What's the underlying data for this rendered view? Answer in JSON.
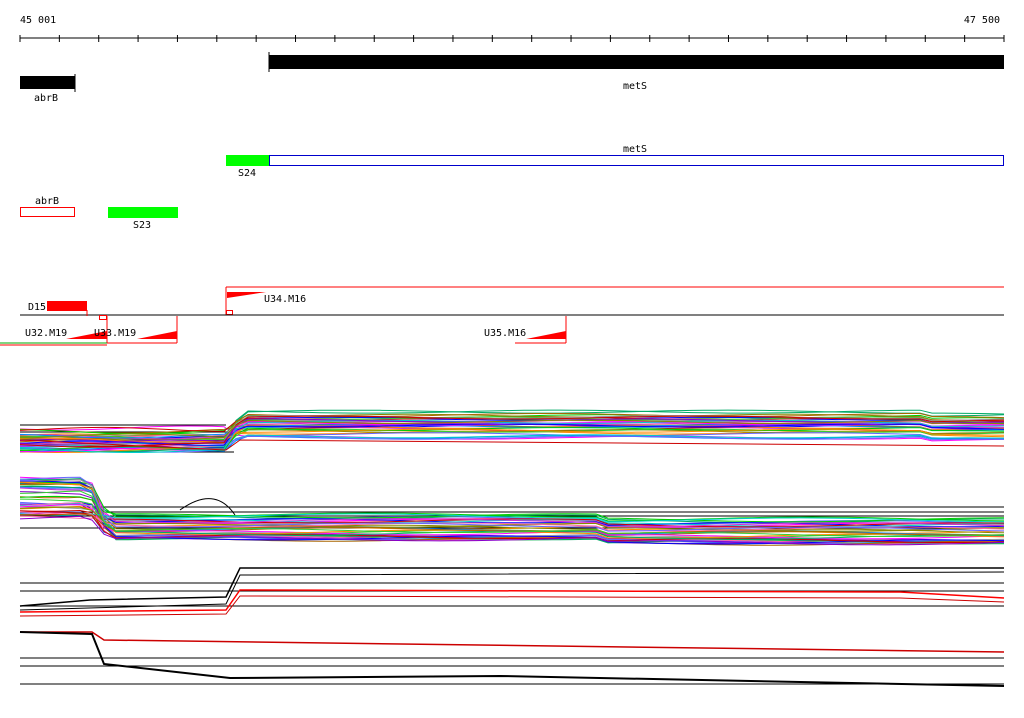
{
  "ruler": {
    "start_label": "45 001",
    "end_label": "47 500"
  },
  "genes": [
    {
      "label": "abrB"
    },
    {
      "label": "metS"
    }
  ],
  "transcripts": [
    {
      "label": "metS"
    },
    {
      "label": "S24"
    },
    {
      "label": "abrB"
    },
    {
      "label": "S23"
    }
  ],
  "segments": [
    {
      "label": "U34.M16"
    },
    {
      "label": "D15"
    },
    {
      "label": "U32.M19"
    },
    {
      "label": "U33.M19"
    },
    {
      "label": "U35.M16"
    }
  ],
  "colors": {
    "gene": "#000000",
    "transcript_green": "#00ff00",
    "transcript_blue_outline": "#0000cc",
    "antisense_outline": "#ff0000",
    "segment_red": "#ff0000",
    "baseline": "#000000"
  }
}
